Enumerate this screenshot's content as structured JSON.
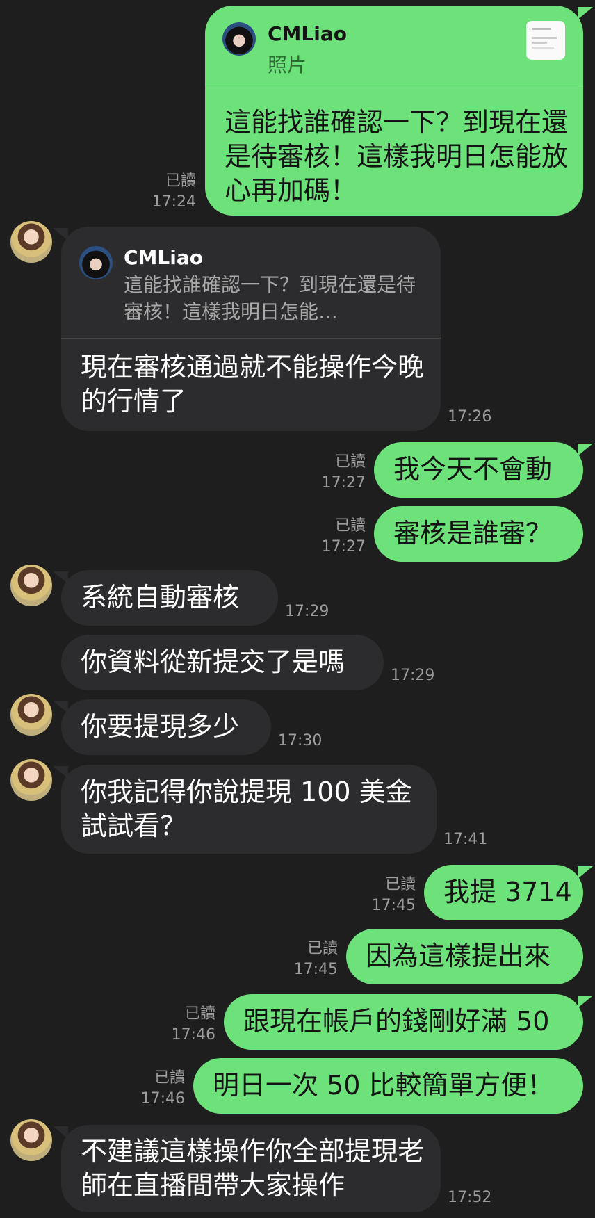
{
  "chat": {
    "read_label": "已讀",
    "msg1": {
      "reply_name": "CMLiao",
      "reply_type": "照片",
      "text": "這能找誰確認一下？到現在還是待審核！這樣我明日怎能放心再加碼！",
      "read": "已讀",
      "time": "17:24"
    },
    "msg2": {
      "reply_name": "CMLiao",
      "reply_preview": "這能找誰確認一下？到現在還是待審核！這樣我明日怎能…",
      "text": "現在審核通過就不能操作今晚的行情了",
      "time": "17:26"
    },
    "msg3": {
      "text": "我今天不會動",
      "read": "已讀",
      "time": "17:27"
    },
    "msg4": {
      "text": "審核是誰審？",
      "read": "已讀",
      "time": "17:27"
    },
    "msg5": {
      "text": "系統自動審核",
      "time": "17:29"
    },
    "msg6": {
      "text": "你資料從新提交了是嗎",
      "time": "17:29"
    },
    "msg7": {
      "text": "你要提現多少",
      "time": "17:30"
    },
    "msg8": {
      "text": "你我記得你說提現 100 美金試試看？",
      "time": "17:41"
    },
    "msg9": {
      "text": "我提 3714",
      "read": "已讀",
      "time": "17:45"
    },
    "msg10": {
      "text": "因為這樣提出來",
      "read": "已讀",
      "time": "17:45"
    },
    "msg11": {
      "text": "跟現在帳戶的錢剛好滿 50",
      "read": "已讀",
      "time": "17:46"
    },
    "msg12": {
      "text": "明日一次 50 比較簡單方便！",
      "read": "已讀",
      "time": "17:46"
    },
    "msg13": {
      "text": "不建議這樣操作你全部提現老師在直播間帶大家操作",
      "time": "17:52"
    }
  },
  "colors": {
    "background": "#1e1e1e",
    "outgoing_bubble": "#6ee27a",
    "incoming_bubble": "#2c2c2e",
    "meta_text": "#9c9c9c"
  }
}
